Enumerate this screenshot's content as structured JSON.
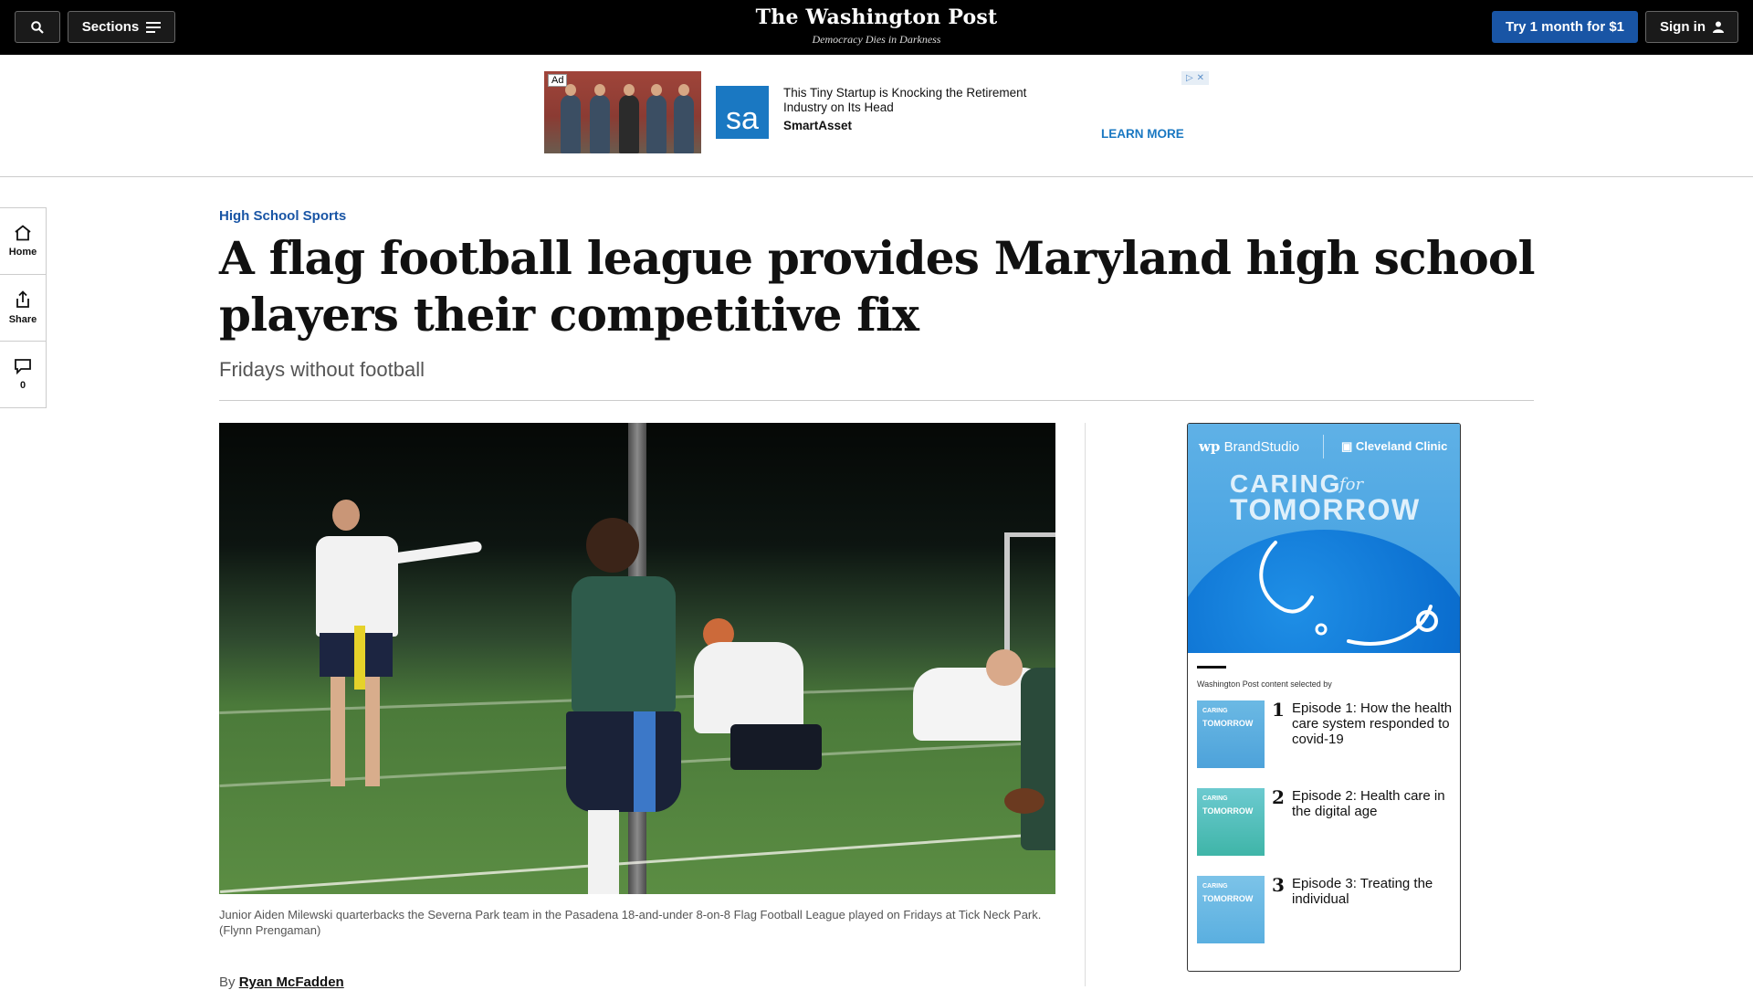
{
  "topbar": {
    "sections_label": "Sections",
    "try_label": "Try 1 month for $1",
    "signin_label": "Sign in",
    "logo": "The Washington Post",
    "tagline": "Democracy Dies in Darkness",
    "icons": [
      "search-icon",
      "menu-icon",
      "user-icon"
    ]
  },
  "ad": {
    "label": "Ad",
    "logo_text": "sa",
    "headline": "This Tiny Startup is Knocking the Retirement Industry on Its Head",
    "brand": "SmartAsset",
    "cta": "LEARN MORE"
  },
  "rail": {
    "home_label": "Home",
    "share_label": "Share",
    "comments_count": "0"
  },
  "article": {
    "kicker": "High School Sports",
    "headline": "A flag football league provides Maryland high school players their competitive fix",
    "subhead": "Fridays without football",
    "caption": "Junior Aiden Milewski quarterbacks the Severna Park team in the Pasadena 18-and-under 8-on-8 Flag Football League played on Fridays at Tick Neck Park. (Flynn Prengaman)",
    "byline_prefix": "By",
    "author": "Ryan McFadden"
  },
  "brand_studio": {
    "wp_label": "BrandStudio",
    "sponsor": "Cleveland Clinic",
    "hero_caring": "CARING",
    "hero_for": "for",
    "hero_tomorrow": "TOMORROW",
    "note": "Washington Post content selected by",
    "episodes": [
      {
        "num": "1",
        "title": "Episode 1: How the health care system responded to covid-19"
      },
      {
        "num": "2",
        "title": "Episode 2: Health care in the digital age"
      },
      {
        "num": "3",
        "title": "Episode 3: Treating the individual"
      }
    ]
  }
}
